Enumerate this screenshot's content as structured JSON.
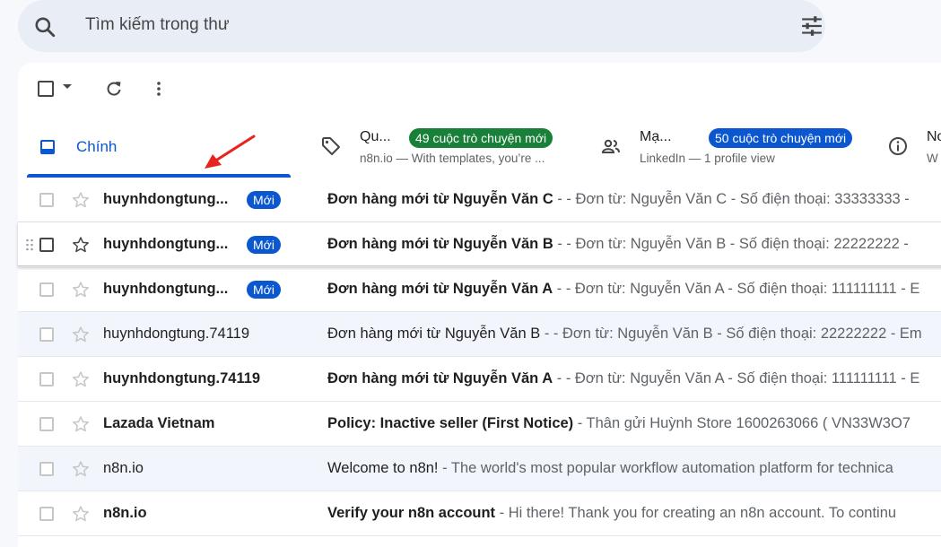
{
  "search": {
    "placeholder": "Tìm kiếm trong thư"
  },
  "tabs": {
    "primary": {
      "label": "Chính"
    },
    "promotions": {
      "title": "Qu...",
      "badge": "49 cuộc trò chuyện mới",
      "snippet": "n8n.io — With templates, you’re ..."
    },
    "social": {
      "title": "Mạ...",
      "badge": "50 cuộc trò chuyện mới",
      "snippet": "LinkedIn — 1 profile view"
    },
    "updates": {
      "title": "No",
      "snippet": "W"
    }
  },
  "colors": {
    "accent": "#0b57d0",
    "promo_badge": "#188038",
    "arrow": "#e8231f"
  },
  "emails": [
    {
      "sender": "huynhdongtung...",
      "badge": "Mới",
      "subject": "Đơn hàng mới từ Nguyễn Văn C",
      "snippet": " - - Đơn từ: Nguyễn Văn C - Số điện thoại: 33333333 - ",
      "unread": true
    },
    {
      "sender": "huynhdongtung...",
      "badge": "Mới",
      "subject": "Đơn hàng mới từ Nguyễn Văn B",
      "snippet": " - - Đơn từ: Nguyễn Văn B - Số điện thoại: 22222222 - ",
      "unread": true
    },
    {
      "sender": "huynhdongtung...",
      "badge": "Mới",
      "subject": "Đơn hàng mới từ Nguyễn Văn A",
      "snippet": " - - Đơn từ: Nguyễn Văn A - Số điện thoại: 111111111 - E",
      "unread": true
    },
    {
      "sender": "huynhdongtung.74119",
      "badge": "",
      "subject": "Đơn hàng mới từ Nguyễn Văn B",
      "snippet": " - - Đơn từ: Nguyễn Văn B - Số điện thoại: 22222222 - Em",
      "unread": false
    },
    {
      "sender": "huynhdongtung.74119",
      "badge": "",
      "subject": "Đơn hàng mới từ Nguyễn Văn A",
      "snippet": " - - Đơn từ: Nguyễn Văn A - Số điện thoại: 111111111 - E",
      "unread": true
    },
    {
      "sender": "Lazada Vietnam",
      "badge": "",
      "subject": "Policy: Inactive seller (First Notice)",
      "snippet": " - Thân gửi Huỳnh Store 1600263066 ( VN33W3O7",
      "unread": true
    },
    {
      "sender": "n8n.io",
      "badge": "",
      "subject": "Welcome to n8n!",
      "snippet": " - The world's most popular workflow automation platform for technica",
      "unread": false
    },
    {
      "sender": "n8n.io",
      "badge": "",
      "subject": "Verify your n8n account",
      "snippet": " - Hi there! Thank you for creating an n8n account. To continu",
      "unread": true
    }
  ]
}
